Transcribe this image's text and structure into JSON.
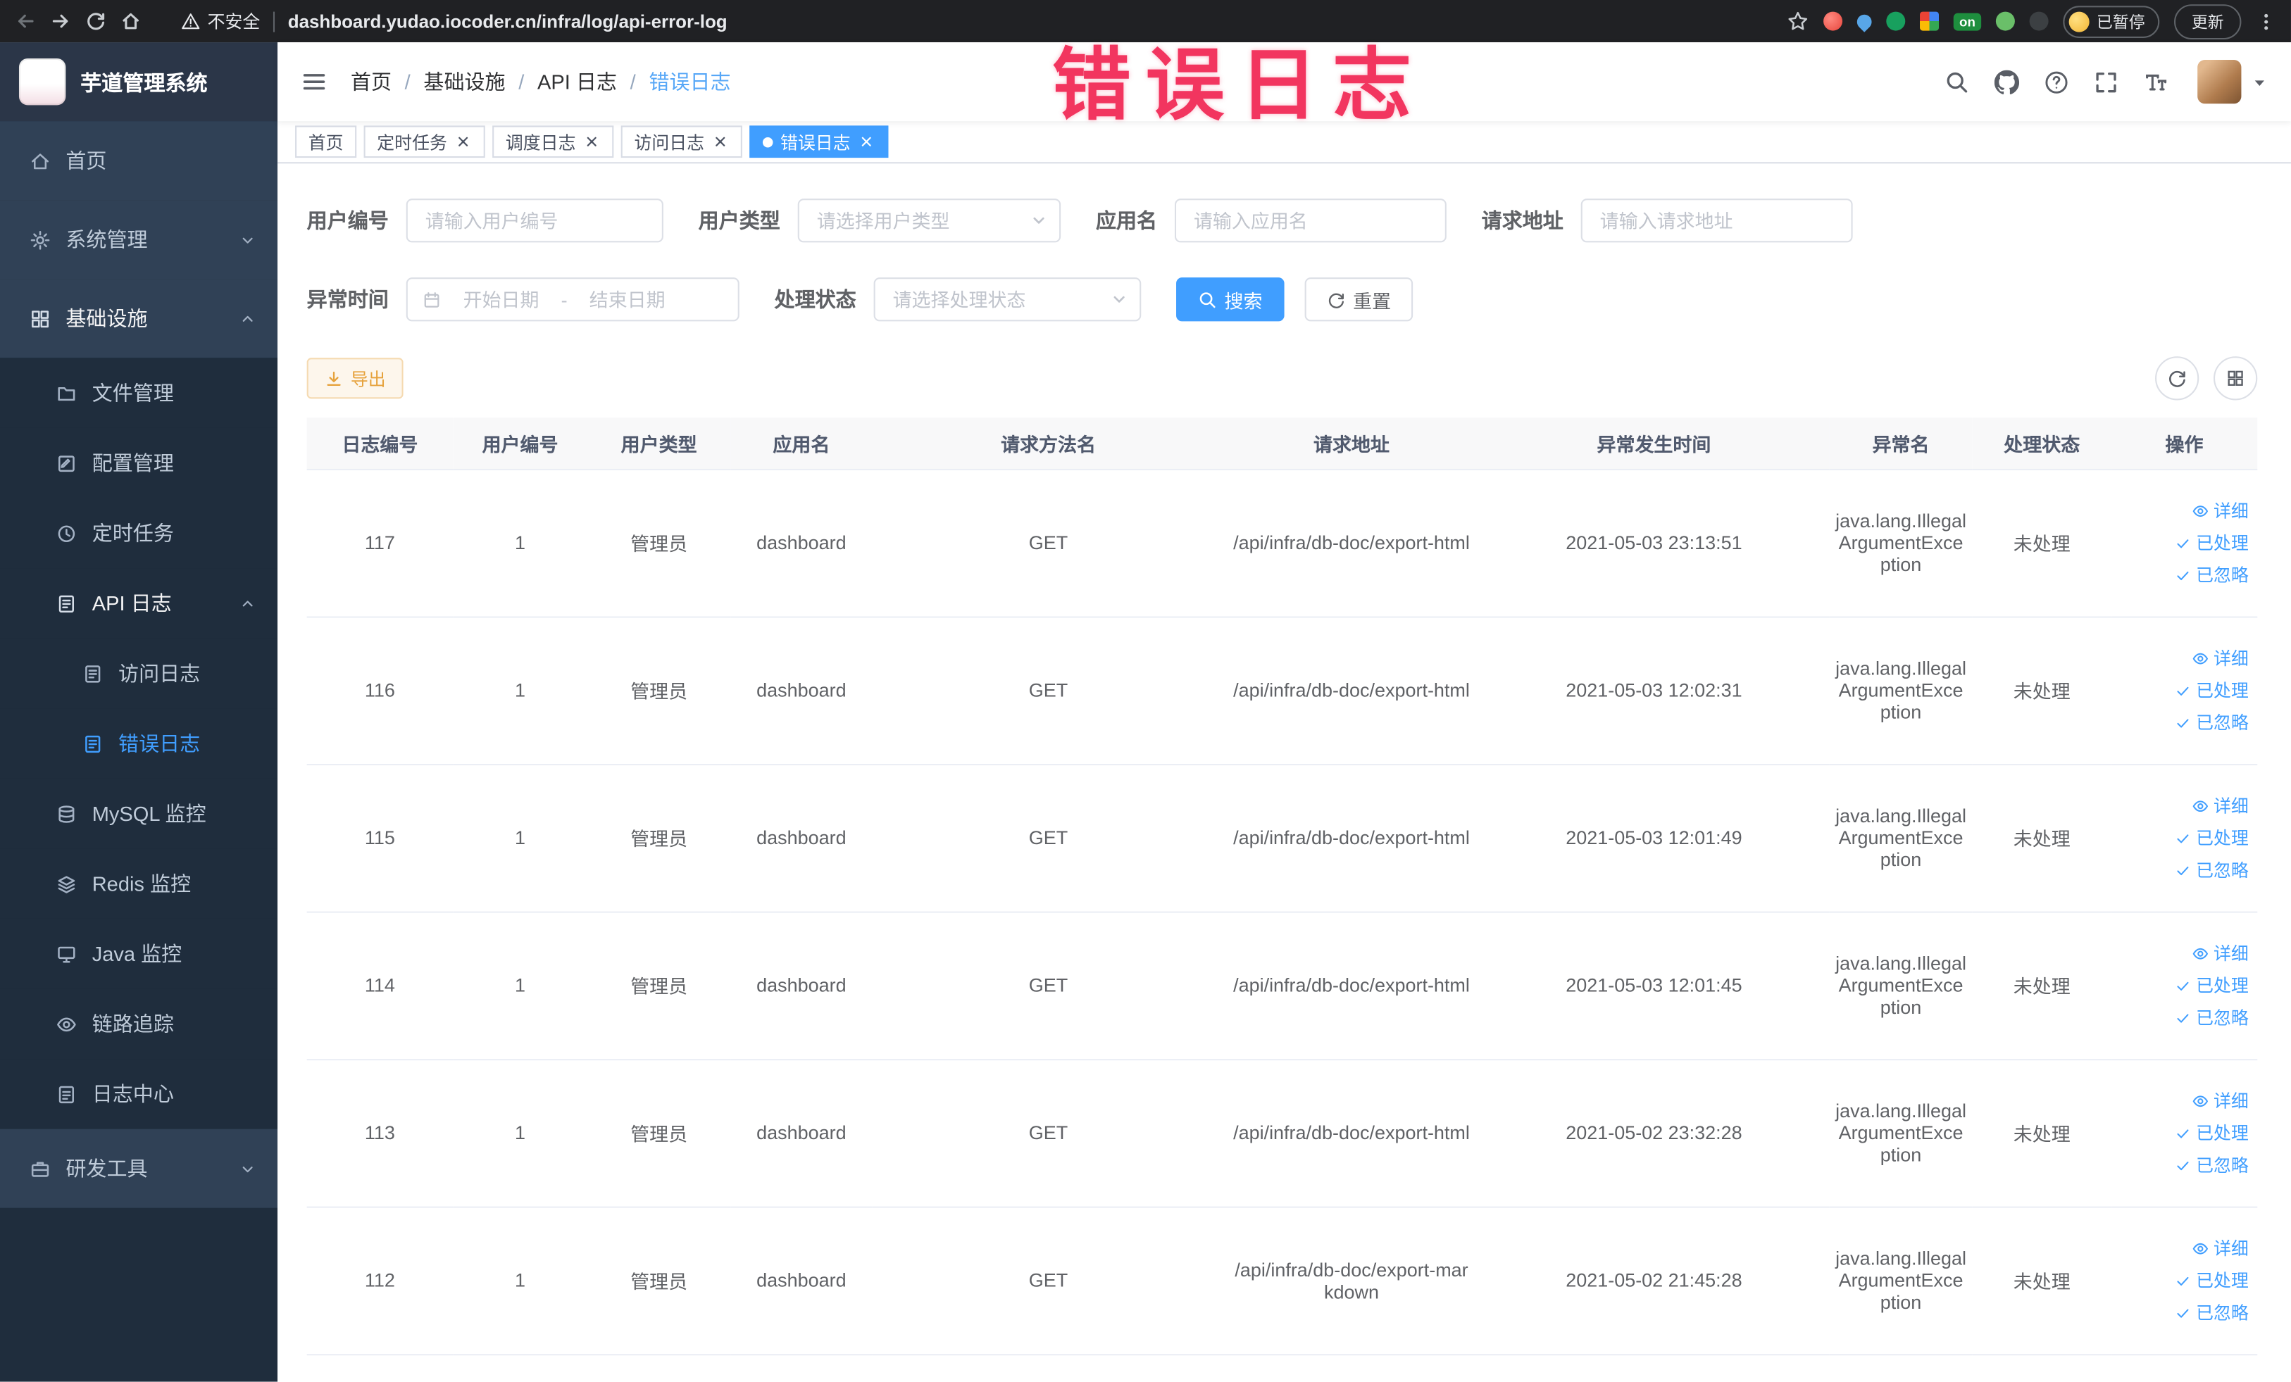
{
  "annotation": {
    "text": "错误日志",
    "color": "#f2355f"
  },
  "browser": {
    "security_warning": "不安全",
    "url": "dashboard.yudao.iocoder.cn/infra/log/api-error-log",
    "extension_on_badge": "on",
    "profile_badge": "已暂停",
    "update_button": "更新"
  },
  "sidebar": {
    "brand": "芋道管理系统",
    "items": [
      {
        "label": "首页",
        "icon": "home-icon",
        "arrow": ""
      },
      {
        "label": "系统管理",
        "icon": "gear-icon",
        "arrow": "chevron-down-icon"
      },
      {
        "label": "基础设施",
        "icon": "grid-icon",
        "arrow": "chevron-up-icon",
        "open": true
      },
      {
        "label": "文件管理",
        "icon": "folder-icon",
        "arrow": "",
        "sub": true
      },
      {
        "label": "配置管理",
        "icon": "edit-icon",
        "arrow": "",
        "sub": true
      },
      {
        "label": "定时任务",
        "icon": "clock-icon",
        "arrow": "",
        "sub": true
      },
      {
        "label": "API 日志",
        "icon": "doc-edit-icon",
        "arrow": "chevron-up-icon",
        "sub": true,
        "open": true
      },
      {
        "label": "访问日志",
        "icon": "doc-edit-icon",
        "arrow": "",
        "subsub": true
      },
      {
        "label": "错误日志",
        "icon": "doc-edit-icon",
        "arrow": "",
        "subsub": true,
        "active": true
      },
      {
        "label": "MySQL 监控",
        "icon": "db-icon",
        "arrow": "",
        "sub": true
      },
      {
        "label": "Redis 监控",
        "icon": "layers-icon",
        "arrow": "",
        "sub": true
      },
      {
        "label": "Java 监控",
        "icon": "monitor-icon",
        "arrow": "",
        "sub": true
      },
      {
        "label": "链路追踪",
        "icon": "eye-icon",
        "arrow": "",
        "sub": true
      },
      {
        "label": "日志中心",
        "icon": "doc-icon",
        "arrow": "",
        "sub": true
      },
      {
        "label": "研发工具",
        "icon": "briefcase-icon",
        "arrow": "chevron-down-icon"
      }
    ]
  },
  "header": {
    "breadcrumb_separator": "/",
    "breadcrumb": [
      {
        "label": "首页"
      },
      {
        "label": "基础设施",
        "sep": true
      },
      {
        "label": "API 日志",
        "sep": true
      },
      {
        "label": "错误日志",
        "sep": true,
        "last": true
      }
    ]
  },
  "tabs": [
    {
      "label": "首页"
    },
    {
      "label": "定时任务",
      "closable": true
    },
    {
      "label": "调度日志",
      "closable": true
    },
    {
      "label": "访问日志",
      "closable": true
    },
    {
      "label": "错误日志",
      "closable": true,
      "active": true
    }
  ],
  "filters": {
    "user_id": {
      "label": "用户编号",
      "placeholder": "请输入用户编号"
    },
    "user_type": {
      "label": "用户类型",
      "placeholder": "请选择用户类型"
    },
    "app_name": {
      "label": "应用名",
      "placeholder": "请输入应用名"
    },
    "request_url": {
      "label": "请求地址",
      "placeholder": "请输入请求地址"
    },
    "exception_time": {
      "label": "异常时间",
      "start_placeholder": "开始日期",
      "separator": "-",
      "end_placeholder": "结束日期"
    },
    "process_status": {
      "label": "处理状态",
      "placeholder": "请选择处理状态"
    },
    "search_button": "搜索",
    "reset_button": "重置"
  },
  "toolbar": {
    "export_button": "导出"
  },
  "table": {
    "columns": [
      "日志编号",
      "用户编号",
      "用户类型",
      "应用名",
      "请求方法名",
      "请求地址",
      "异常发生时间",
      "异常名",
      "处理状态",
      "操作"
    ],
    "actions": [
      {
        "label": "详细",
        "icon": "eye-icon"
      },
      {
        "label": "已处理",
        "icon": "check-icon"
      },
      {
        "label": "已忽略",
        "icon": "check-icon"
      }
    ],
    "rows": [
      {
        "id": "117",
        "user_id": "1",
        "user_type": "管理员",
        "app": "dashboard",
        "method": "GET",
        "url": "/api/infra/db-doc/export-html",
        "time": "2021-05-03 23:13:51",
        "exception": "java.lang.IllegalArgumentException",
        "status": "未处理"
      },
      {
        "id": "116",
        "user_id": "1",
        "user_type": "管理员",
        "app": "dashboard",
        "method": "GET",
        "url": "/api/infra/db-doc/export-html",
        "time": "2021-05-03 12:02:31",
        "exception": "java.lang.IllegalArgumentException",
        "status": "未处理"
      },
      {
        "id": "115",
        "user_id": "1",
        "user_type": "管理员",
        "app": "dashboard",
        "method": "GET",
        "url": "/api/infra/db-doc/export-html",
        "time": "2021-05-03 12:01:49",
        "exception": "java.lang.IllegalArgumentException",
        "status": "未处理"
      },
      {
        "id": "114",
        "user_id": "1",
        "user_type": "管理员",
        "app": "dashboard",
        "method": "GET",
        "url": "/api/infra/db-doc/export-html",
        "time": "2021-05-03 12:01:45",
        "exception": "java.lang.IllegalArgumentException",
        "status": "未处理"
      },
      {
        "id": "113",
        "user_id": "1",
        "user_type": "管理员",
        "app": "dashboard",
        "method": "GET",
        "url": "/api/infra/db-doc/export-html",
        "time": "2021-05-02 23:32:28",
        "exception": "java.lang.IllegalArgumentException",
        "status": "未处理"
      },
      {
        "id": "112",
        "user_id": "1",
        "user_type": "管理员",
        "app": "dashboard",
        "method": "GET",
        "url": "/api/infra/db-doc/export-markdown",
        "time": "2021-05-02 21:45:28",
        "exception": "java.lang.IllegalArgumentException",
        "status": "未处理"
      }
    ]
  }
}
